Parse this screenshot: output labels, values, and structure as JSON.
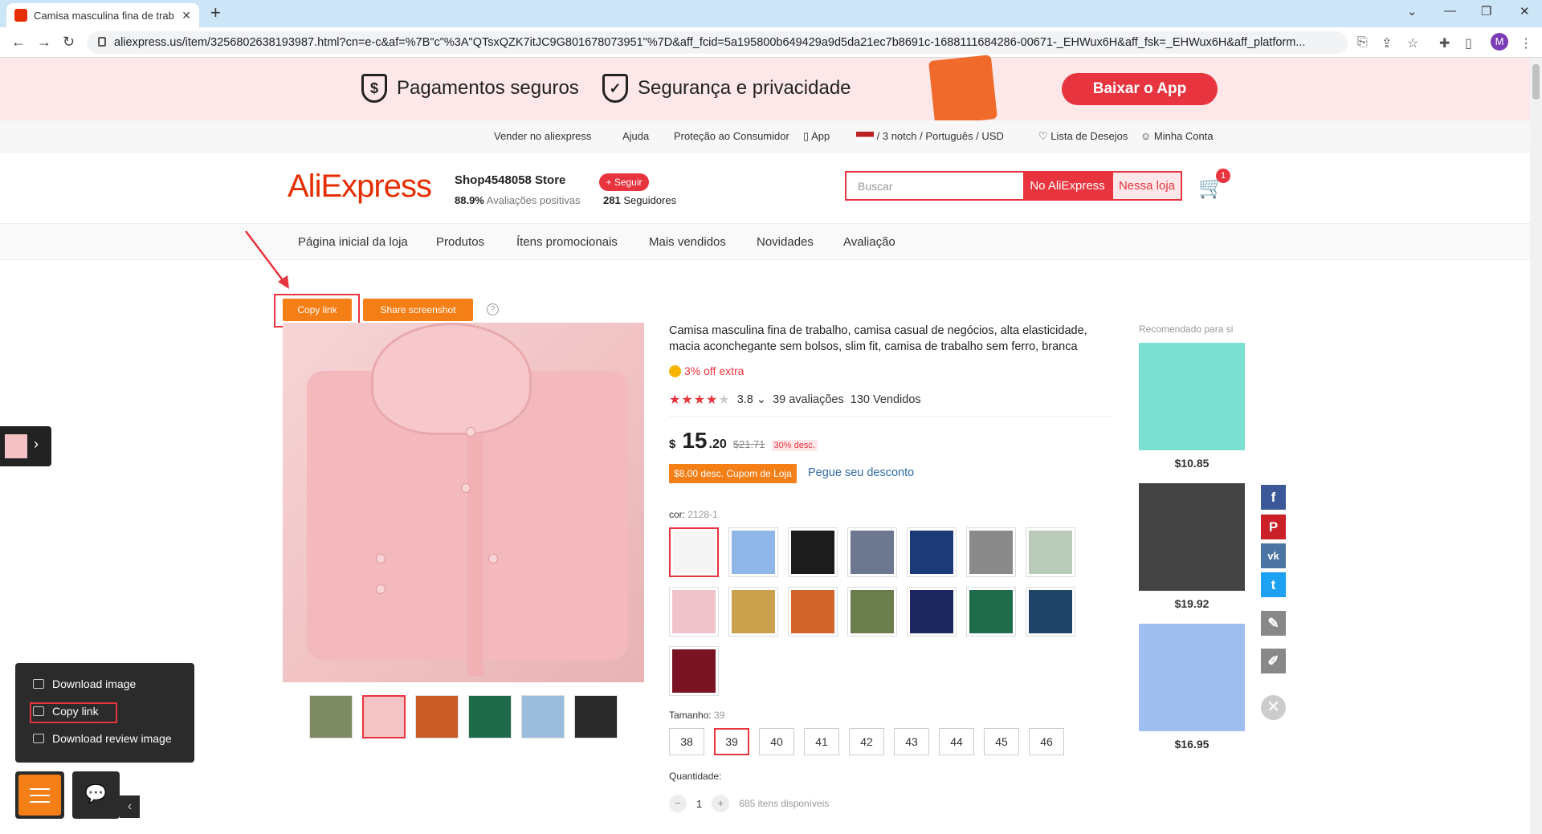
{
  "browser": {
    "tab_title": "Camisa masculina fina de trab",
    "tab_close": "✕",
    "new_tab": "+",
    "url": "aliexpress.us/item/3256802638193987.html?cn=e-c&af=%7B\"c\"%3A\"QTsxQZK7itJC9G801678073951\"%7D&aff_fcid=5a195800b649429a9d5da21ec7b8691c-1688111684286-00671-_EHWux6H&aff_fsk=_EHWux6H&aff_platform...",
    "avatar_letter": "M"
  },
  "banner": {
    "secure_payments": "Pagamentos seguros",
    "security_privacy": "Segurança e privacidade",
    "app_button": "Baixar o App"
  },
  "toplinks": {
    "sell": "Vender no aliexpress",
    "help": "Ajuda",
    "protection": "Proteção ao Consumidor",
    "app": "App",
    "locale": "/ 3 notch / Português / USD",
    "wishlist": "Lista de Desejos",
    "account": "Minha Conta"
  },
  "header": {
    "logo": "AliExpress",
    "store_name": "Shop4548058 Store",
    "positive_pct": "88.9%",
    "positive_label": "Avaliações positivas",
    "follow": "+ Seguir",
    "followers_count": "281",
    "followers_label": "Seguidores",
    "search_placeholder": "Buscar",
    "btn_aliexpress": "No AliExpress",
    "btn_store": "Nessa loja",
    "cart_count": "1"
  },
  "storenav": [
    "Página inicial da loja",
    "Produtos",
    "Ítens promocionais",
    "Mais vendidos",
    "Novidades",
    "Avaliação"
  ],
  "tools": {
    "copy_link": "Copy link",
    "share_screenshot": "Share screenshot",
    "help": "?"
  },
  "product": {
    "title": "Camisa masculina fina de trabalho, camisa casual de negócios, alta elasticidade, macia aconchegante sem bolsos, slim fit, camisa de trabalho sem ferro, branca",
    "extra_off": "3% off extra",
    "rating": "3.8",
    "reviews": "39 avaliações",
    "sold": "130 Vendidos",
    "currency": "$",
    "price_int": "15",
    "price_cents": ".20",
    "old_price": "$21.71",
    "discount": "30% desc.",
    "coupon": "$8.00 desc. Cupom de Loja",
    "coupon_link": "Pegue seu desconto",
    "color_label": "cor:",
    "color_value": "2128-1",
    "size_label": "Tamanho:",
    "size_value": "39",
    "sizes": [
      "38",
      "39",
      "40",
      "41",
      "42",
      "43",
      "44",
      "45",
      "46"
    ],
    "qty_label": "Quantidade:",
    "qty_minus": "−",
    "qty_value": "1",
    "qty_plus": "+",
    "available": "685 itens disponíveis"
  },
  "swatch_colors": [
    "#f5f5f5",
    "#8fb6e6",
    "#1c1c1c",
    "#6e7790",
    "#1d3a78",
    "#8a8a8a",
    "#b9cbb8",
    "#f0c3cb",
    "#c9a04c",
    "#d2652a",
    "#6b7d4c",
    "#1e2660",
    "#1f6b4a",
    "#1f4566",
    "#7a1424"
  ],
  "thumb_colors": [
    "#7d8a62",
    "#f3c3c6",
    "#c85b26",
    "#1e6b4c",
    "#9cbcdd",
    "#2a2a2a"
  ],
  "recommended": {
    "header": "Recomendado para si",
    "items": [
      {
        "price": "$10.85",
        "color": "#7be0d0"
      },
      {
        "price": "$19.92",
        "color": "#444444"
      },
      {
        "price": "$16.95",
        "color": "#9fbff0"
      }
    ]
  },
  "social": {
    "facebook": "f",
    "pinterest": "P",
    "vk": "vk",
    "twitter": "t",
    "edit": "✎",
    "pen": "✐",
    "close": "✕"
  },
  "popup": {
    "download_image": "Download image",
    "copy_link": "Copy link",
    "download_review": "Download review image"
  },
  "floating": {
    "chat": "💬",
    "collapse": "‹",
    "left_chevron": "›"
  }
}
